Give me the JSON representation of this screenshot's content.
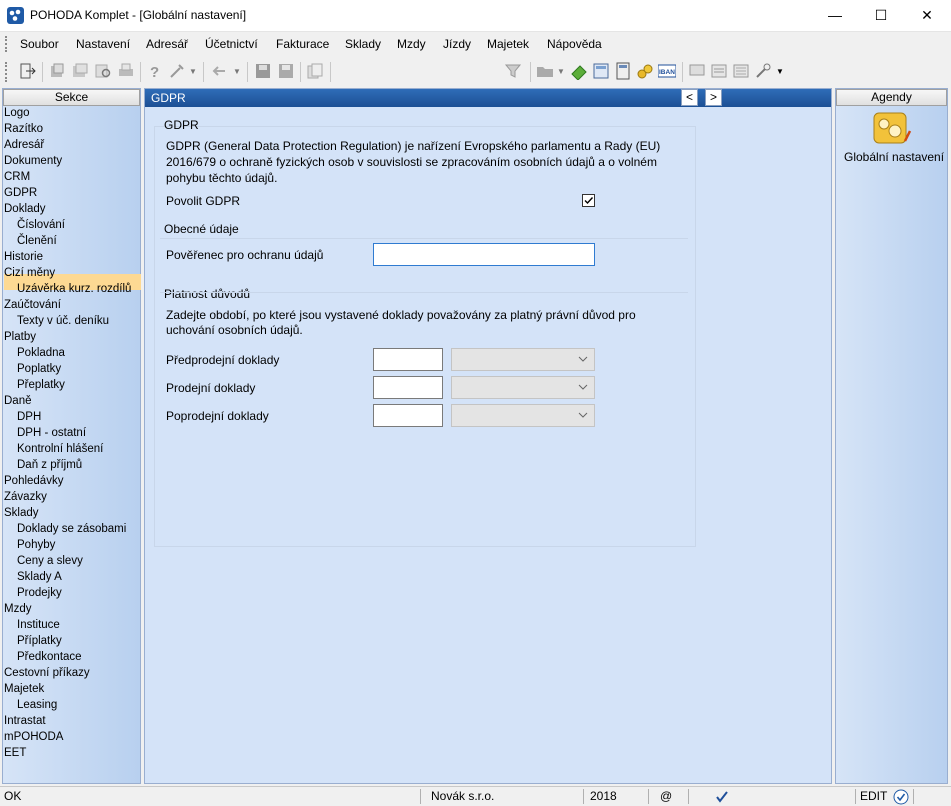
{
  "window": {
    "title": "POHODA Komplet - [Globální nastavení]",
    "min": "—",
    "max": "☐",
    "close": "✕"
  },
  "menu": [
    "Soubor",
    "Nastavení",
    "Adresář",
    "Účetnictví",
    "Fakturace",
    "Sklady",
    "Mzdy",
    "Jízdy",
    "Majetek",
    "Nápověda"
  ],
  "toolbar": {
    "agenda_value": "fra"
  },
  "sidebar": {
    "header": "Sekce",
    "items": [
      "Logo",
      "Razítko",
      "Adresář",
      "Dokumenty",
      "CRM",
      "GDPR",
      "Doklady",
      "Číslování",
      "Členění",
      "Historie",
      "Cizí měny",
      "Uzávěrka kurz. rozdílů",
      "Zaúčtování",
      "Texty v úč. deníku",
      "Platby",
      "Pokladna",
      "Poplatky",
      "Přeplatky",
      "Daně",
      "DPH",
      "DPH - ostatní",
      "Kontrolní hlášení",
      "Daň z příjmů",
      "Pohledávky",
      "Závazky",
      "Sklady",
      "Doklady se zásobami",
      "Pohyby",
      "Ceny a slevy",
      "Sklady A",
      "Prodejky",
      "Mzdy",
      "Instituce",
      "Příplatky",
      "Předkontace",
      "Cestovní příkazy",
      "Majetek",
      "Leasing",
      "Intrastat",
      "mPOHODA",
      "EET"
    ],
    "selected": "GDPR"
  },
  "main": {
    "header": "GDPR",
    "prev": "<",
    "next": ">",
    "section_title": "GDPR",
    "description_line1": "GDPR (General Data Protection Regulation) je nařízení Evropského parlamentu a Rady (EU)",
    "description_line2": "2016/679 o ochraně fyzických osob v souvislosti se zpracováním osobních údajů a o volném",
    "description_line3": "pohybu těchto údajů.",
    "enable_label": "Povolit GDPR",
    "enable_checked": true,
    "general_title": "Obecné údaje",
    "officer_label": "Pověřenec pro ochranu údajů",
    "officer_value": "",
    "validity_title": "Platnost důvodů",
    "validity_desc_line1": "Zadejte období, po které jsou vystavené doklady považovány za platný právní důvod pro",
    "validity_desc_line2": "uchování osobních údajů.",
    "rows": [
      {
        "label": "Předprodejní doklady",
        "value": "",
        "unit": ""
      },
      {
        "label": "Prodejní doklady",
        "value": "",
        "unit": ""
      },
      {
        "label": "Poprodejní doklady",
        "value": "",
        "unit": ""
      }
    ]
  },
  "agenda": {
    "header": "Agendy",
    "item": "Globální nastavení"
  },
  "status": {
    "state": "OK",
    "company": "Novák s.r.o.",
    "year": "2018",
    "at": "@",
    "mode": "EDIT"
  }
}
